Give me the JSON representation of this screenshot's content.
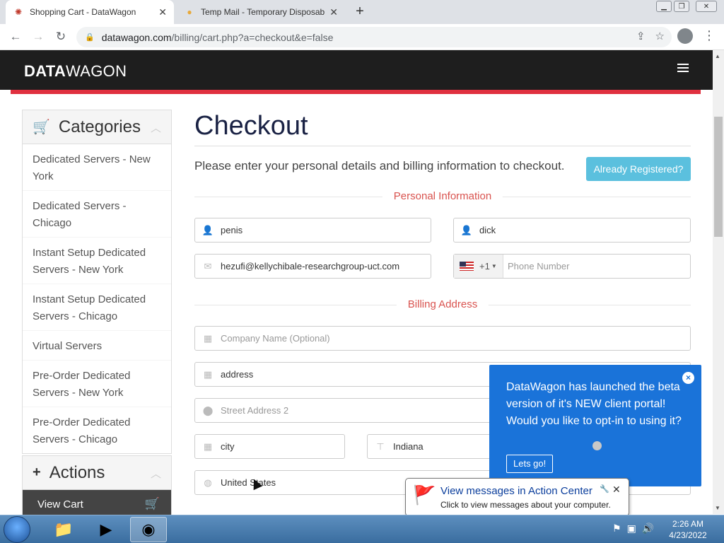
{
  "browser": {
    "tabs": [
      {
        "title": "Shopping Cart - DataWagon",
        "favicon": "gear-favicon-icon"
      },
      {
        "title": "Temp Mail - Temporary Disposab",
        "favicon": "mail-favicon-icon"
      }
    ],
    "url_host": "datawagon.com",
    "url_path": "/billing/cart.php?a=checkout&e=false"
  },
  "site": {
    "logo_bold": "DATA",
    "logo_light": "WAGON",
    "accent_color": "#e0303f"
  },
  "sidebar": {
    "categories_title": "Categories",
    "categories": [
      "Dedicated Servers - New York",
      "Dedicated Servers - Chicago",
      "Instant Setup Dedicated Servers - New York",
      "Instant Setup Dedicated Servers - Chicago",
      "Virtual Servers",
      "Pre-Order Dedicated Servers - New York",
      "Pre-Order Dedicated Servers - Chicago"
    ],
    "actions_title": "Actions",
    "view_cart": "View Cart"
  },
  "main": {
    "title": "Checkout",
    "intro": "Please enter your personal details and billing information to checkout.",
    "already_registered": "Already Registered?",
    "personal_section": "Personal Information",
    "billing_section": "Billing Address",
    "first_name": "penis",
    "last_name": "dick",
    "email": "hezufi@kellychibale-researchgroup-uct.com",
    "phone_code": "+1",
    "phone_placeholder": "Phone Number",
    "company_placeholder": "Company Name (Optional)",
    "address1": "address",
    "address2_placeholder": "Street Address 2",
    "city": "city",
    "state": "Indiana",
    "country": "United States"
  },
  "popup": {
    "text": "DataWagon has launched the beta version of it's NEW client portal! Would you like to opt-in to using it?",
    "button": "Lets go!",
    "close": "×"
  },
  "balloon": {
    "title": "View messages in Action Center",
    "subtitle": "Click to view messages about your computer."
  },
  "taskbar": {
    "time": "2:26 AM",
    "date": "4/23/2022"
  }
}
